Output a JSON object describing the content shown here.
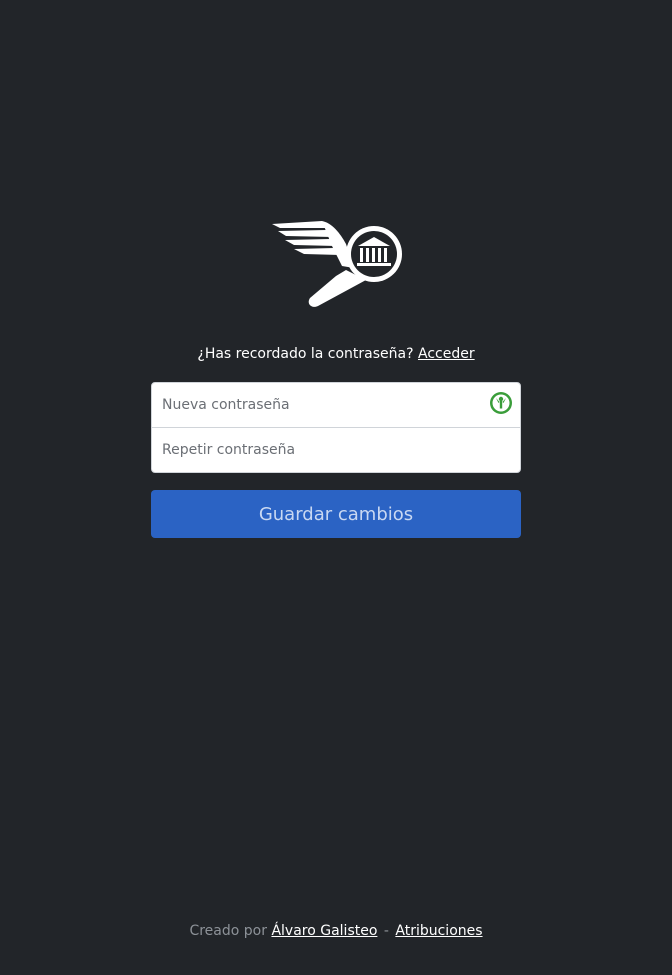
{
  "logo": {
    "icon": "winged-magnifier-museum-icon",
    "color": "#ffffff"
  },
  "login_prompt": {
    "question": "¿Has recordado la contraseña?",
    "link_label": "Acceder"
  },
  "form": {
    "new_password_placeholder": "Nueva contraseña",
    "repeat_password_placeholder": "Repetir contraseña",
    "password_manager_icon": "password-manager-icon",
    "submit_label": "Guardar cambios"
  },
  "footer": {
    "created_by": "Creado por",
    "author": "Álvaro Galisteo",
    "separator": "-",
    "attributions": "Atribuciones"
  },
  "colors": {
    "background": "#222529",
    "button": "#2b63c4",
    "button_text": "#c9d8f2",
    "footer_text": "#8d9298",
    "password_icon": "#3a9d3a"
  }
}
